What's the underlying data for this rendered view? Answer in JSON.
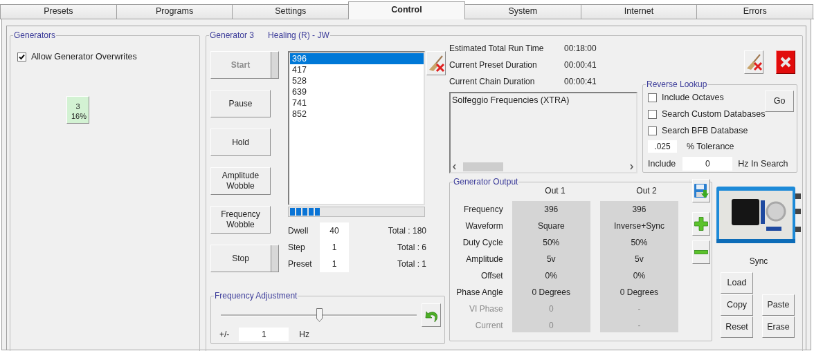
{
  "tabs": [
    {
      "label": "Presets",
      "selected": false
    },
    {
      "label": "Programs",
      "selected": false
    },
    {
      "label": "Settings",
      "selected": false
    },
    {
      "label": "Control",
      "selected": true
    },
    {
      "label": "System",
      "selected": false
    },
    {
      "label": "Internet",
      "selected": false
    },
    {
      "label": "Errors",
      "selected": false
    }
  ],
  "generators": {
    "title": "Generators",
    "allow_overwrites": {
      "label": "Allow Generator Overwrites",
      "checked": true
    },
    "tiles": [
      {
        "number": "3",
        "percent": "16%"
      }
    ]
  },
  "generator": {
    "title": "Generator 3",
    "preset_name": "Healing (R) - JW",
    "buttons": [
      {
        "label": "Start",
        "kind": "split",
        "disabled": true
      },
      {
        "label": "Pause",
        "kind": "plain",
        "disabled": false
      },
      {
        "label": "Hold",
        "kind": "plain",
        "disabled": false
      },
      {
        "label": "Amplitude Wobble",
        "kind": "plain",
        "disabled": false
      },
      {
        "label": "Frequency Wobble",
        "kind": "plain",
        "disabled": false
      },
      {
        "label": "Stop",
        "kind": "split",
        "disabled": false
      }
    ],
    "frequencies": [
      {
        "value": "396",
        "selected": true
      },
      {
        "value": "417",
        "selected": false
      },
      {
        "value": "528",
        "selected": false
      },
      {
        "value": "639",
        "selected": false
      },
      {
        "value": "741",
        "selected": false
      },
      {
        "value": "852",
        "selected": false
      }
    ],
    "progress": {
      "level": 0.23
    },
    "counters": [
      {
        "label": "Dwell",
        "value": "40",
        "total": "Total : 180"
      },
      {
        "label": "Step",
        "value": "1",
        "total": "Total : 6"
      },
      {
        "label": "Preset",
        "value": "1",
        "total": "Total : 1"
      }
    ],
    "frequency_adjustment": {
      "title": "Frequency Adjustment",
      "level": 0.505,
      "step_label": "+/-",
      "step": "1",
      "unit": "Hz"
    },
    "timings": [
      {
        "label": "Estimated Total Run Time",
        "value": "00:18:00"
      },
      {
        "label": "Current Preset Duration",
        "value": "00:00:41"
      },
      {
        "label": "Current Chain Duration",
        "value": "00:00:41"
      }
    ],
    "description": "Solfeggio Frequencies (XTRA)",
    "reverse_lookup": {
      "title": "Reverse Lookup",
      "options": [
        {
          "label": "Include Octaves",
          "checked": false
        },
        {
          "label": "Search Custom Databases",
          "checked": false
        },
        {
          "label": "Search BFB Database",
          "checked": false
        }
      ],
      "go": "Go",
      "tolerance": ".025",
      "tolerance_label": "% Tolerance",
      "include_label": "Include",
      "include_value": "0",
      "include_unit": "Hz In Search"
    },
    "output": {
      "title": "Generator Output",
      "columns": [
        "Out 1",
        "Out 2"
      ],
      "rows": [
        {
          "label": "Frequency",
          "out_1": "396",
          "out_2": "396",
          "disabled": false
        },
        {
          "label": "Waveform",
          "out_1": "Square",
          "out_2": "Inverse+Sync",
          "disabled": false
        },
        {
          "label": "Duty Cycle",
          "out_1": "50%",
          "out_2": "50%",
          "disabled": false
        },
        {
          "label": "Amplitude",
          "out_1": "5v",
          "out_2": "5v",
          "disabled": false
        },
        {
          "label": "Offset",
          "out_1": "0%",
          "out_2": "0%",
          "disabled": false
        },
        {
          "label": "Phase Angle",
          "out_1": "0 Degrees",
          "out_2": "0 Degrees",
          "disabled": false
        },
        {
          "label": "VI Phase",
          "out_1": "0",
          "out_2": "-",
          "disabled": true
        },
        {
          "label": "Current",
          "out_1": "0",
          "out_2": "-",
          "disabled": true
        }
      ]
    },
    "sync": {
      "label": "Sync",
      "buttons": [
        "Load",
        "Copy",
        "Paste",
        "Reset",
        "Erase"
      ]
    }
  }
}
